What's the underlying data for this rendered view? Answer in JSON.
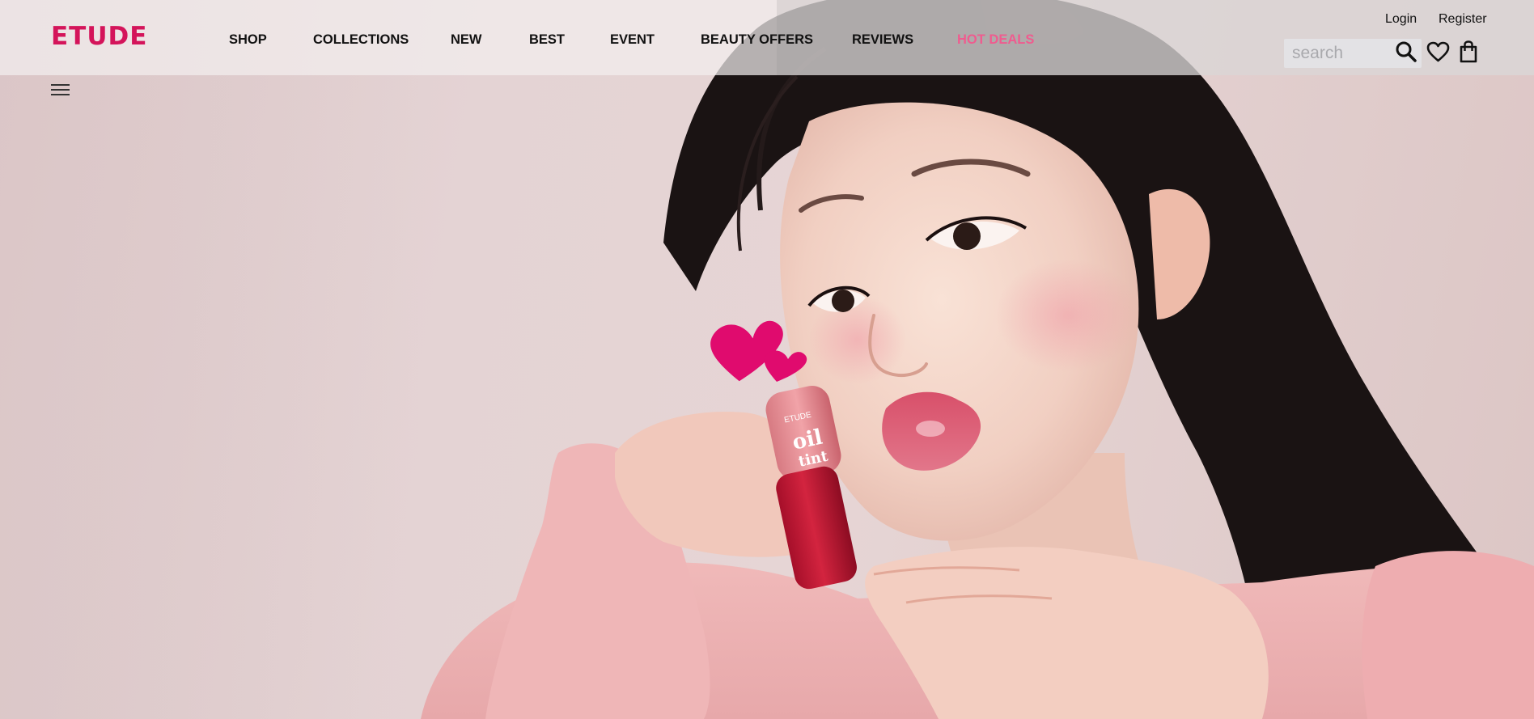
{
  "brand": {
    "logo_text": "ETUDE"
  },
  "nav": {
    "items": [
      {
        "label": "SHOP"
      },
      {
        "label": "COLLECTIONS"
      },
      {
        "label": "NEW"
      },
      {
        "label": "BEST"
      },
      {
        "label": "EVENT"
      },
      {
        "label": "BEAUTY OFFERS"
      },
      {
        "label": "REVIEWS"
      },
      {
        "label": "HOT DEALS"
      }
    ]
  },
  "account": {
    "login_label": "Login",
    "register_label": "Register"
  },
  "search": {
    "placeholder": "search",
    "value": ""
  },
  "icons": {
    "search": "search-icon",
    "wishlist": "heart-icon",
    "cart": "shopping-bag-icon",
    "menu": "hamburger-menu-icon"
  },
  "hero": {
    "product_brand": "ETUDE",
    "product_name_line1": "oil",
    "product_name_line2": "tint"
  },
  "colors": {
    "brand_pink": "#d4145a",
    "hot_deals_pink": "#ef5c8f",
    "heart_pink": "#e00b6e",
    "tint_red": "#c01432",
    "background": "#e4d3d4"
  }
}
